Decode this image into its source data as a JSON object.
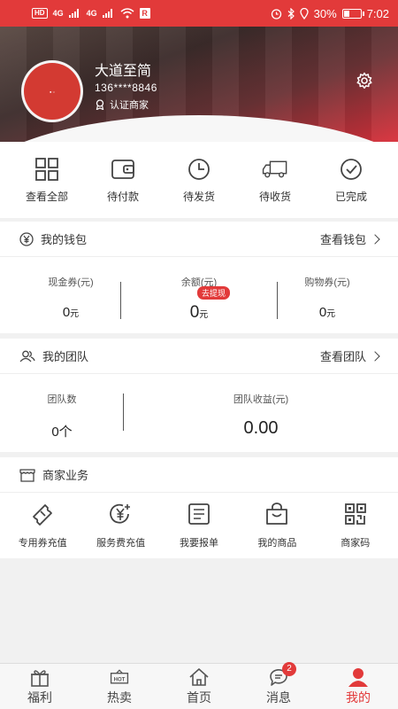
{
  "status_bar": {
    "battery": "30%",
    "time": "7:02",
    "network_left": "4G",
    "network_right": "4G",
    "hd": "HD"
  },
  "profile": {
    "name": "大道至简",
    "phone": "136****8846",
    "badge": "认证商家"
  },
  "orders": [
    {
      "label": "查看全部",
      "icon": "grid-icon"
    },
    {
      "label": "待付款",
      "icon": "wallet-icon"
    },
    {
      "label": "待发货",
      "icon": "clock-icon"
    },
    {
      "label": "待收货",
      "icon": "truck-icon"
    },
    {
      "label": "已完成",
      "icon": "check-circle-icon"
    }
  ],
  "wallet": {
    "title": "我的钱包",
    "link": "查看钱包",
    "cash_label": "现金券(元)",
    "cash_value": "0",
    "unit": "元",
    "balance_label": "余额(元)",
    "balance_value": "0",
    "withdraw": "去提现",
    "shopping_label": "购物券(元)",
    "shopping_value": "0"
  },
  "team": {
    "title": "我的团队",
    "link": "查看团队",
    "count_label": "团队数",
    "count_value": "0个",
    "income_label": "团队收益(元)",
    "income_value": "0.00"
  },
  "business": {
    "title": "商家业务",
    "items": [
      {
        "label": "专用券充值",
        "icon": "ticket-icon"
      },
      {
        "label": "服务费充值",
        "icon": "yuan-plus-icon"
      },
      {
        "label": "我要报单",
        "icon": "form-icon"
      },
      {
        "label": "我的商品",
        "icon": "bag-icon"
      },
      {
        "label": "商家码",
        "icon": "qr-code-icon"
      }
    ]
  },
  "nav": [
    {
      "label": "福利",
      "icon": "gift-icon"
    },
    {
      "label": "热卖",
      "icon": "hot-icon",
      "icon_text": "HOT"
    },
    {
      "label": "首页",
      "icon": "home-icon"
    },
    {
      "label": "消息",
      "icon": "message-icon",
      "badge": "2"
    },
    {
      "label": "我的",
      "icon": "user-icon",
      "active": true
    }
  ],
  "colors": {
    "accent": "#e23a3a"
  }
}
